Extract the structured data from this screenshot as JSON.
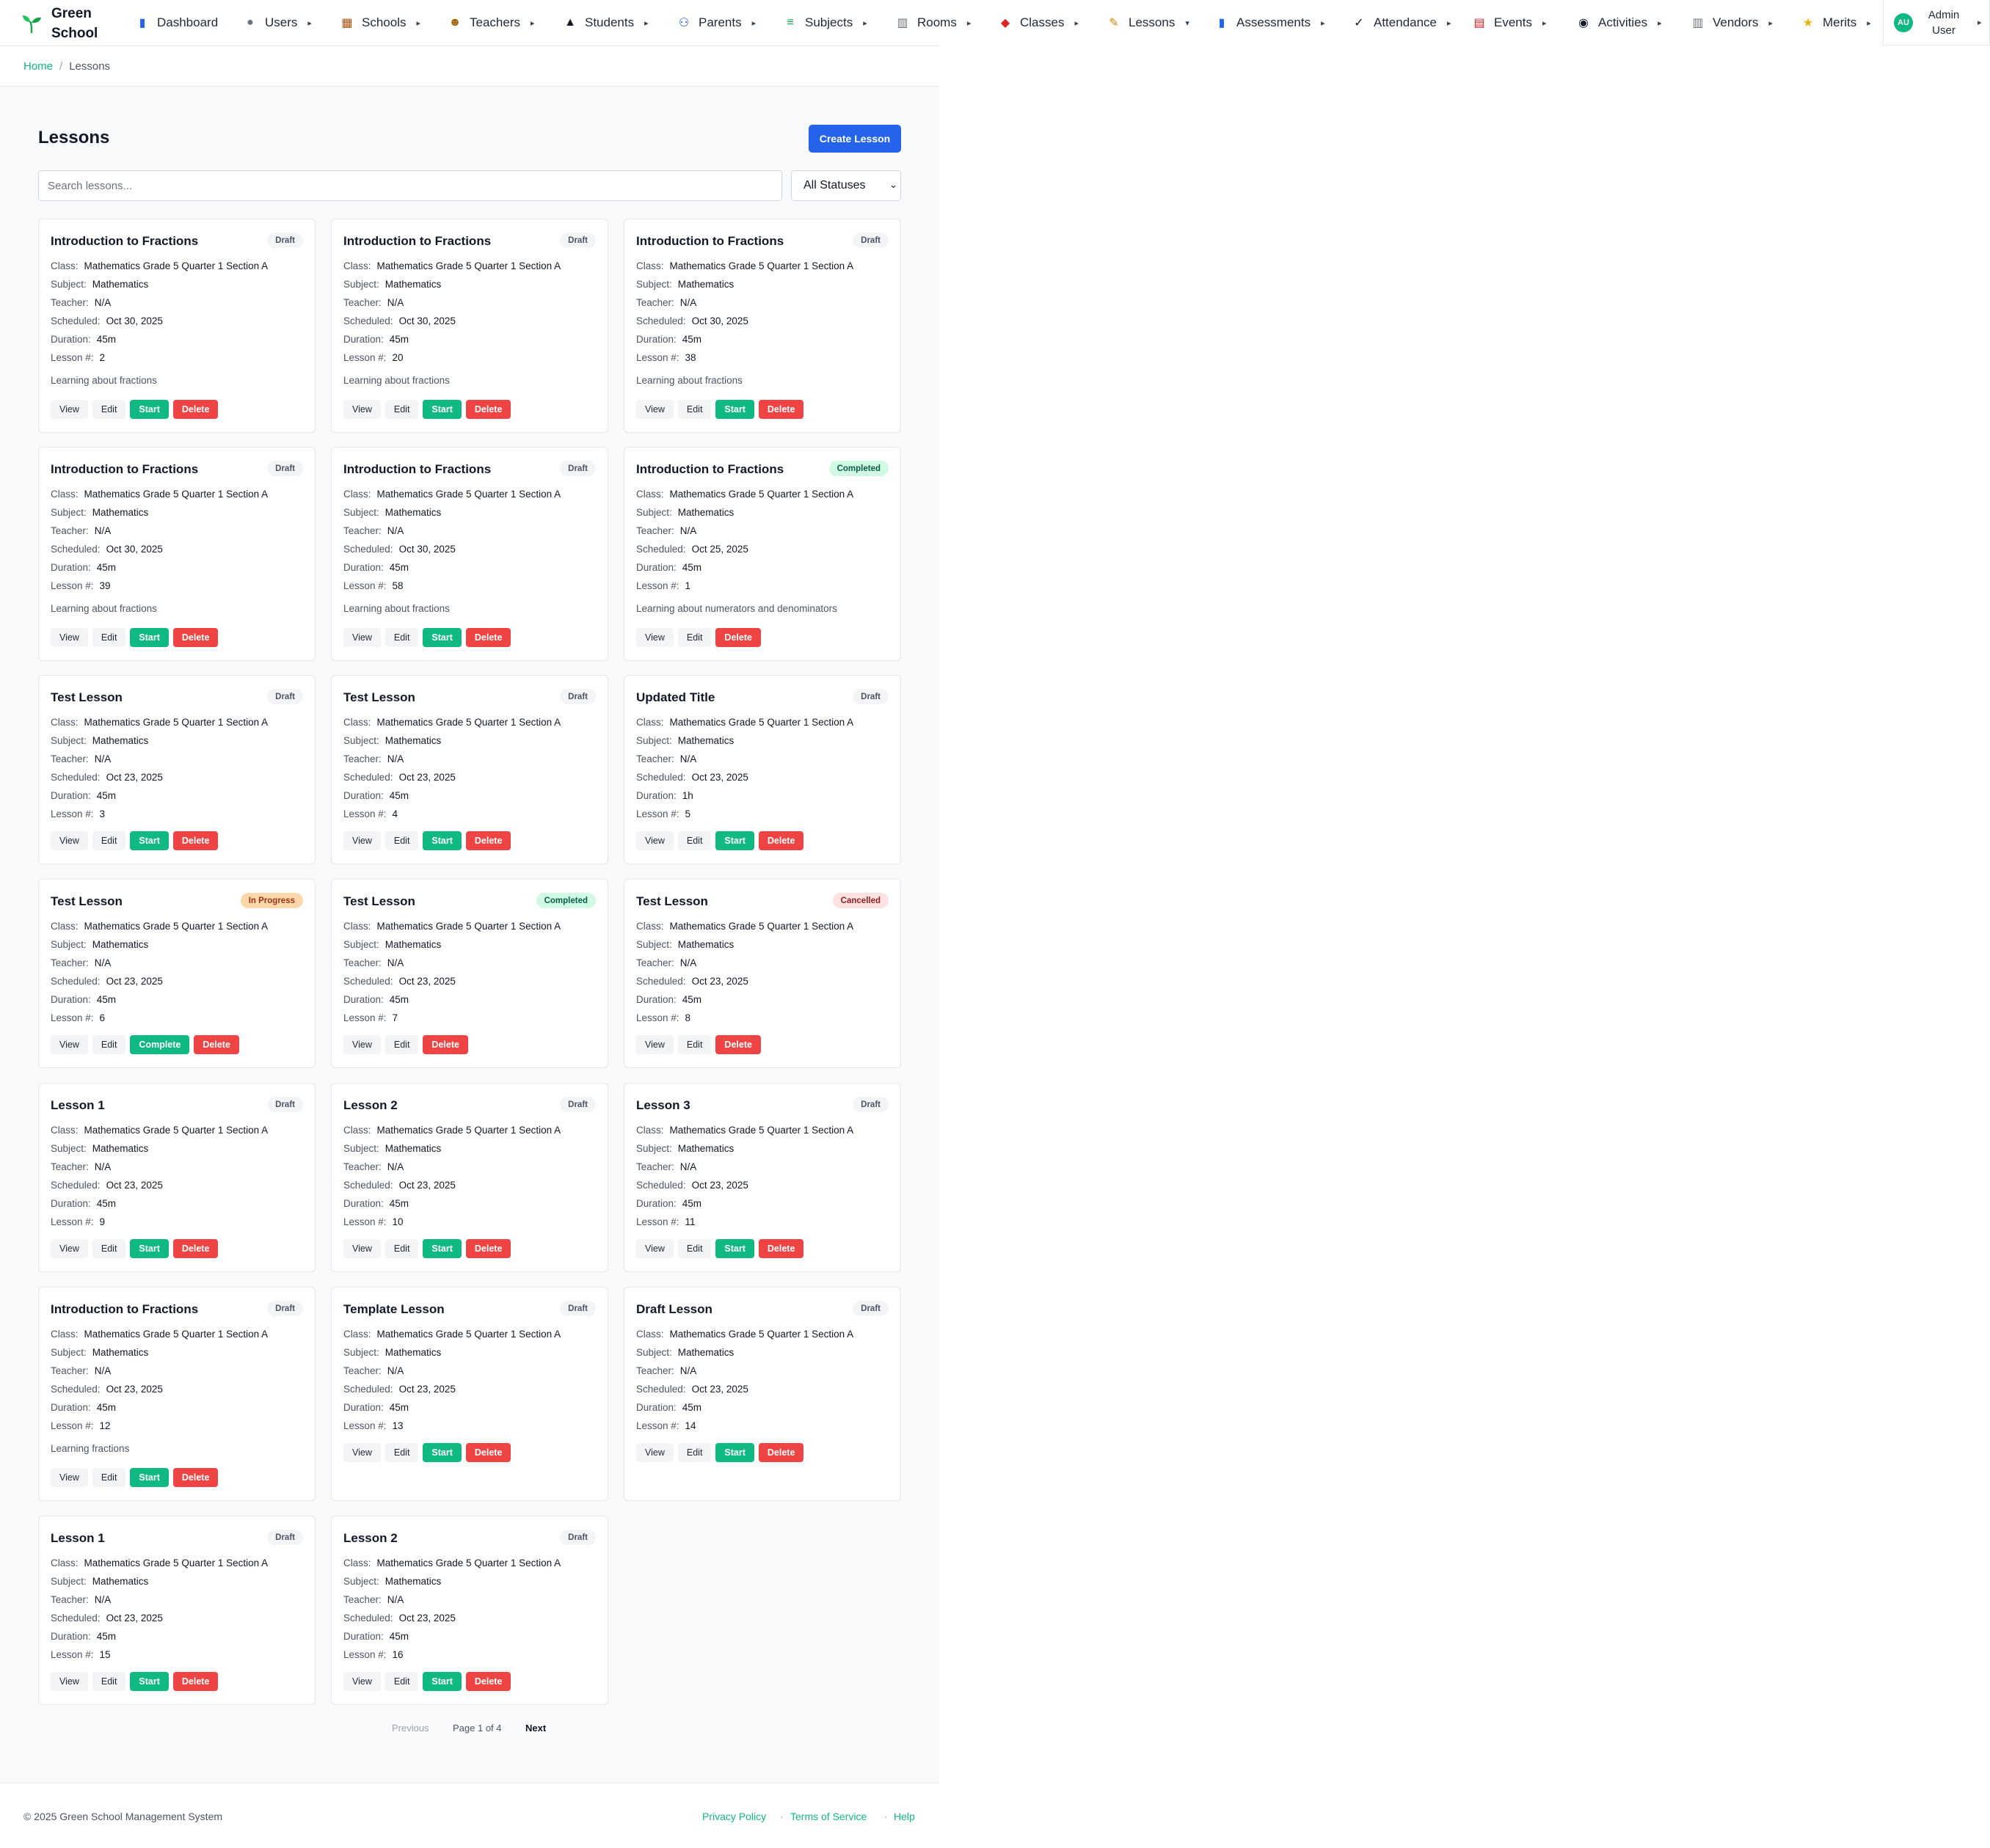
{
  "brand": {
    "line1": "Green",
    "line2": "School"
  },
  "nav": [
    {
      "label": "Dashboard",
      "icon": "chart-icon",
      "glyph": "▮",
      "color": "#2563eb",
      "caret": ""
    },
    {
      "label": "Users",
      "icon": "users-icon",
      "glyph": "●",
      "color": "#6b7280",
      "caret": "▸"
    },
    {
      "label": "Schools",
      "icon": "school-icon",
      "glyph": "▦",
      "color": "#b45309",
      "caret": "▸"
    },
    {
      "label": "Teachers",
      "icon": "teacher-icon",
      "glyph": "☻",
      "color": "#a16207",
      "caret": "▸"
    },
    {
      "label": "Students",
      "icon": "graduation-cap-icon",
      "glyph": "▲",
      "color": "#111827",
      "caret": "▸"
    },
    {
      "label": "Parents",
      "icon": "family-icon",
      "glyph": "⚇",
      "color": "#1d4ed8",
      "caret": "▸"
    },
    {
      "label": "Subjects",
      "icon": "books-icon",
      "glyph": "≡",
      "color": "#16a34a",
      "caret": "▸"
    },
    {
      "label": "Rooms",
      "icon": "building-icon",
      "glyph": "▥",
      "color": "#6b7280",
      "caret": "▸"
    },
    {
      "label": "Classes",
      "icon": "backpack-icon",
      "glyph": "◆",
      "color": "#dc2626",
      "caret": "▸"
    },
    {
      "label": "Lessons",
      "icon": "memo-icon",
      "glyph": "✎",
      "color": "#ca8a04",
      "caret": "▾"
    },
    {
      "label": "Assessments",
      "icon": "bar-chart-icon",
      "glyph": "▮",
      "color": "#2563eb",
      "caret": "▸"
    },
    {
      "label": "Attendance",
      "icon": "check-icon",
      "glyph": "✓",
      "color": "#111827",
      "caret": "▸"
    },
    {
      "label": "Events",
      "icon": "calendar-icon",
      "glyph": "▤",
      "color": "#dc2626",
      "caret": "▸"
    },
    {
      "label": "Activities",
      "icon": "soccer-ball-icon",
      "glyph": "◉",
      "color": "#111827",
      "caret": "▸"
    },
    {
      "label": "Vendors",
      "icon": "office-icon",
      "glyph": "▥",
      "color": "#6b7280",
      "caret": "▸"
    },
    {
      "label": "Merits",
      "icon": "star-icon",
      "glyph": "★",
      "color": "#eab308",
      "caret": "▸"
    }
  ],
  "user": {
    "initials": "AU",
    "line1": "Admin",
    "line2": "User",
    "caret": "▸"
  },
  "breadcrumb": {
    "home": "Home",
    "sep": "/",
    "current": "Lessons"
  },
  "page": {
    "title": "Lessons",
    "create_label": "Create Lesson"
  },
  "search": {
    "placeholder": "Search lessons...",
    "value": ""
  },
  "status_filter": {
    "selected": "All Statuses",
    "chev": "⌄"
  },
  "labels": {
    "class": "Class:",
    "subject": "Subject:",
    "teacher": "Teacher:",
    "scheduled": "Scheduled:",
    "duration": "Duration:",
    "lesson_no": "Lesson #:"
  },
  "buttons": {
    "view": "View",
    "edit": "Edit",
    "start": "Start",
    "complete": "Complete",
    "delete": "Delete"
  },
  "lessons": [
    {
      "title": "Introduction to Fractions",
      "status": "Draft",
      "class": "Mathematics Grade 5 Quarter 1 Section A",
      "subject": "Mathematics",
      "teacher": "N/A",
      "scheduled": "Oct 30, 2025",
      "duration": "45m",
      "number": "2",
      "description": "Learning about fractions"
    },
    {
      "title": "Introduction to Fractions",
      "status": "Draft",
      "class": "Mathematics Grade 5 Quarter 1 Section A",
      "subject": "Mathematics",
      "teacher": "N/A",
      "scheduled": "Oct 30, 2025",
      "duration": "45m",
      "number": "20",
      "description": "Learning about fractions"
    },
    {
      "title": "Introduction to Fractions",
      "status": "Draft",
      "class": "Mathematics Grade 5 Quarter 1 Section A",
      "subject": "Mathematics",
      "teacher": "N/A",
      "scheduled": "Oct 30, 2025",
      "duration": "45m",
      "number": "38",
      "description": "Learning about fractions"
    },
    {
      "title": "Introduction to Fractions",
      "status": "Draft",
      "class": "Mathematics Grade 5 Quarter 1 Section A",
      "subject": "Mathematics",
      "teacher": "N/A",
      "scheduled": "Oct 30, 2025",
      "duration": "45m",
      "number": "39",
      "description": "Learning about fractions"
    },
    {
      "title": "Introduction to Fractions",
      "status": "Draft",
      "class": "Mathematics Grade 5 Quarter 1 Section A",
      "subject": "Mathematics",
      "teacher": "N/A",
      "scheduled": "Oct 30, 2025",
      "duration": "45m",
      "number": "58",
      "description": "Learning about fractions"
    },
    {
      "title": "Introduction to Fractions",
      "status": "Completed",
      "class": "Mathematics Grade 5 Quarter 1 Section A",
      "subject": "Mathematics",
      "teacher": "N/A",
      "scheduled": "Oct 25, 2025",
      "duration": "45m",
      "number": "1",
      "description": "Learning about numerators and denominators"
    },
    {
      "title": "Test Lesson",
      "status": "Draft",
      "class": "Mathematics Grade 5 Quarter 1 Section A",
      "subject": "Mathematics",
      "teacher": "N/A",
      "scheduled": "Oct 23, 2025",
      "duration": "45m",
      "number": "3",
      "description": ""
    },
    {
      "title": "Test Lesson",
      "status": "Draft",
      "class": "Mathematics Grade 5 Quarter 1 Section A",
      "subject": "Mathematics",
      "teacher": "N/A",
      "scheduled": "Oct 23, 2025",
      "duration": "45m",
      "number": "4",
      "description": ""
    },
    {
      "title": "Updated Title",
      "status": "Draft",
      "class": "Mathematics Grade 5 Quarter 1 Section A",
      "subject": "Mathematics",
      "teacher": "N/A",
      "scheduled": "Oct 23, 2025",
      "duration": "1h",
      "number": "5",
      "description": ""
    },
    {
      "title": "Test Lesson",
      "status": "In Progress",
      "class": "Mathematics Grade 5 Quarter 1 Section A",
      "subject": "Mathematics",
      "teacher": "N/A",
      "scheduled": "Oct 23, 2025",
      "duration": "45m",
      "number": "6",
      "description": ""
    },
    {
      "title": "Test Lesson",
      "status": "Completed",
      "class": "Mathematics Grade 5 Quarter 1 Section A",
      "subject": "Mathematics",
      "teacher": "N/A",
      "scheduled": "Oct 23, 2025",
      "duration": "45m",
      "number": "7",
      "description": ""
    },
    {
      "title": "Test Lesson",
      "status": "Cancelled",
      "class": "Mathematics Grade 5 Quarter 1 Section A",
      "subject": "Mathematics",
      "teacher": "N/A",
      "scheduled": "Oct 23, 2025",
      "duration": "45m",
      "number": "8",
      "description": ""
    },
    {
      "title": "Lesson 1",
      "status": "Draft",
      "class": "Mathematics Grade 5 Quarter 1 Section A",
      "subject": "Mathematics",
      "teacher": "N/A",
      "scheduled": "Oct 23, 2025",
      "duration": "45m",
      "number": "9",
      "description": ""
    },
    {
      "title": "Lesson 2",
      "status": "Draft",
      "class": "Mathematics Grade 5 Quarter 1 Section A",
      "subject": "Mathematics",
      "teacher": "N/A",
      "scheduled": "Oct 23, 2025",
      "duration": "45m",
      "number": "10",
      "description": ""
    },
    {
      "title": "Lesson 3",
      "status": "Draft",
      "class": "Mathematics Grade 5 Quarter 1 Section A",
      "subject": "Mathematics",
      "teacher": "N/A",
      "scheduled": "Oct 23, 2025",
      "duration": "45m",
      "number": "11",
      "description": ""
    },
    {
      "title": "Introduction to Fractions",
      "status": "Draft",
      "class": "Mathematics Grade 5 Quarter 1 Section A",
      "subject": "Mathematics",
      "teacher": "N/A",
      "scheduled": "Oct 23, 2025",
      "duration": "45m",
      "number": "12",
      "description": "Learning fractions"
    },
    {
      "title": "Template Lesson",
      "status": "Draft",
      "class": "Mathematics Grade 5 Quarter 1 Section A",
      "subject": "Mathematics",
      "teacher": "N/A",
      "scheduled": "Oct 23, 2025",
      "duration": "45m",
      "number": "13",
      "description": ""
    },
    {
      "title": "Draft Lesson",
      "status": "Draft",
      "class": "Mathematics Grade 5 Quarter 1 Section A",
      "subject": "Mathematics",
      "teacher": "N/A",
      "scheduled": "Oct 23, 2025",
      "duration": "45m",
      "number": "14",
      "description": ""
    },
    {
      "title": "Lesson 1",
      "status": "Draft",
      "class": "Mathematics Grade 5 Quarter 1 Section A",
      "subject": "Mathematics",
      "teacher": "N/A",
      "scheduled": "Oct 23, 2025",
      "duration": "45m",
      "number": "15",
      "description": ""
    },
    {
      "title": "Lesson 2",
      "status": "Draft",
      "class": "Mathematics Grade 5 Quarter 1 Section A",
      "subject": "Mathematics",
      "teacher": "N/A",
      "scheduled": "Oct 23, 2025",
      "duration": "45m",
      "number": "16",
      "description": ""
    }
  ],
  "pagination": {
    "previous": "Previous",
    "info": "Page 1 of 4",
    "next": "Next"
  },
  "footer": {
    "copyright": "© 2025 Green School Management System",
    "sep": "·",
    "links": [
      "Privacy Policy",
      "Terms of Service",
      "Help"
    ]
  },
  "colors": {
    "accent_green": "#10b981",
    "primary_blue": "#2563eb",
    "danger_red": "#ef4444"
  }
}
